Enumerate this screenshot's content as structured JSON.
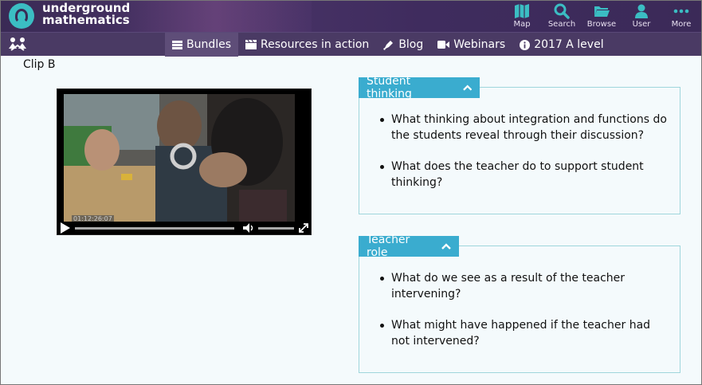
{
  "brand": {
    "line1": "underground",
    "line2": "mathematics"
  },
  "top_nav": [
    {
      "label": "Map",
      "icon": "map-icon"
    },
    {
      "label": "Search",
      "icon": "search-icon"
    },
    {
      "label": "Browse",
      "icon": "folder-icon"
    },
    {
      "label": "User",
      "icon": "user-icon"
    },
    {
      "label": "More",
      "icon": "more-icon"
    }
  ],
  "sub_nav": [
    {
      "label": "Bundles",
      "icon": "bundles-icon",
      "active": true
    },
    {
      "label": "Resources in action",
      "icon": "clapper-icon",
      "active": false
    },
    {
      "label": "Blog",
      "icon": "blog-icon",
      "active": false
    },
    {
      "label": "Webinars",
      "icon": "video-camera-icon",
      "active": false
    },
    {
      "label": "2017 A level",
      "icon": "info-icon",
      "active": false
    }
  ],
  "clip_label": "Clip B",
  "video": {
    "timestamp": "01:12:26:07"
  },
  "panels": [
    {
      "title": "Student thinking",
      "items": [
        "What thinking about integration and functions do the students reveal through their discussion?",
        "What does the teacher do to support student thinking?"
      ]
    },
    {
      "title": "Teacher role",
      "items": [
        "What do we see as a result of the teacher intervening?",
        "What might have happened if the teacher had not intervened?"
      ]
    }
  ],
  "colors": {
    "header_bg": "#3a2a55",
    "subnav_bg": "#4a3a64",
    "accent": "#3aaccf",
    "logo": "#3bbdc3",
    "panel_border": "#9fd6dc",
    "icon_teal": "#3bbdc3"
  }
}
